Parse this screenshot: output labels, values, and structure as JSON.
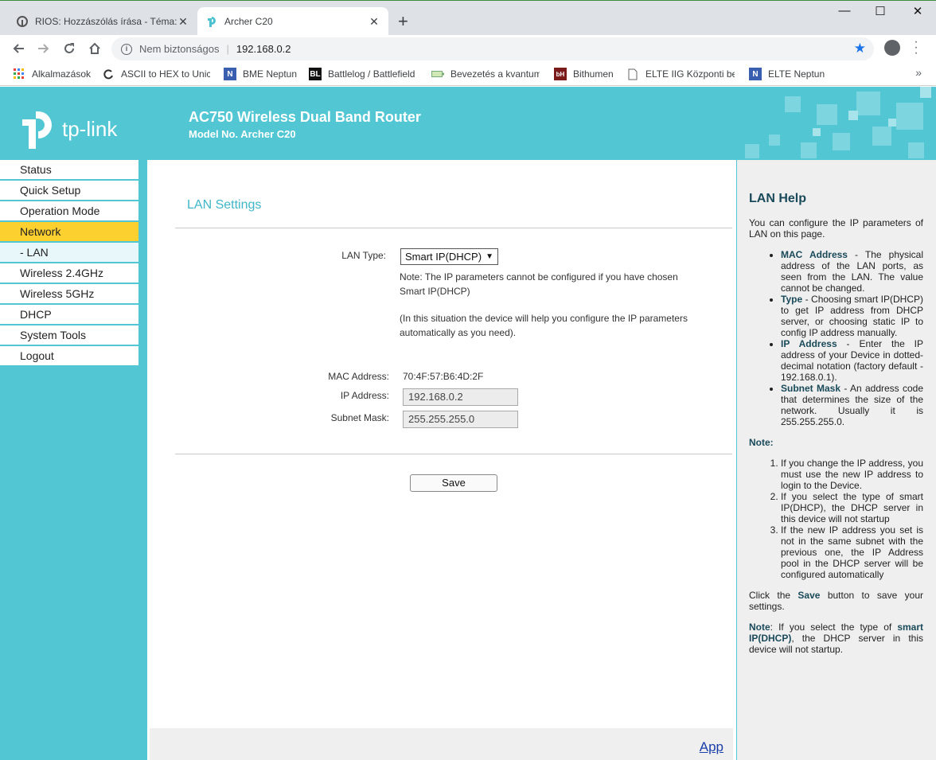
{
  "browser": {
    "tabs": [
      {
        "title": "RIOS: Hozzászólás írása - Téma: M",
        "active": false
      },
      {
        "title": "Archer C20",
        "active": true
      }
    ],
    "new_tab": "+",
    "window": {
      "minimize": "—",
      "maximize": "☐",
      "close": "✕"
    },
    "security_label": "Nem biztonságos",
    "url": "192.168.0.2",
    "bookmarks": [
      {
        "label": "Alkalmazások",
        "icon": "apps-grid-icon"
      },
      {
        "label": "ASCII to HEX to Unico",
        "icon": "rotate-icon"
      },
      {
        "label": "BME Neptun",
        "icon": "neptun-icon"
      },
      {
        "label": "Battlelog / Battlefield",
        "icon": "battlelog-icon"
      },
      {
        "label": "Bevezetés a kvantum",
        "icon": "battery-icon"
      },
      {
        "label": "Bithumen",
        "icon": "bithumen-icon"
      },
      {
        "label": "ELTE IIG Központi bej",
        "icon": "page-icon"
      },
      {
        "label": "ELTE Neptun",
        "icon": "neptun-icon"
      }
    ],
    "bookmarks_more": "»"
  },
  "header": {
    "brand": "tp-link",
    "title": "AC750 Wireless Dual Band Router",
    "model": "Model No. Archer C20"
  },
  "sidebar": {
    "items": [
      {
        "label": "Status",
        "state": "normal"
      },
      {
        "label": "Quick Setup",
        "state": "normal"
      },
      {
        "label": "Operation Mode",
        "state": "normal"
      },
      {
        "label": "Network",
        "state": "active"
      },
      {
        "label": "- LAN",
        "state": "sub"
      },
      {
        "label": "Wireless 2.4GHz",
        "state": "normal"
      },
      {
        "label": "Wireless 5GHz",
        "state": "normal"
      },
      {
        "label": "DHCP",
        "state": "normal"
      },
      {
        "label": "System Tools",
        "state": "normal"
      },
      {
        "label": "Logout",
        "state": "normal"
      }
    ]
  },
  "main": {
    "title": "LAN Settings",
    "lan_type_label": "LAN Type:",
    "lan_type_value": "Smart IP(DHCP)",
    "note1_line1": "Note: The IP parameters cannot be configured if you have chosen",
    "note1_line2": "Smart IP(DHCP)",
    "note2_line1": "(In this situation the device will help you configure the IP parameters",
    "note2_line2": "automatically as you need).",
    "mac_label": "MAC Address:",
    "mac_value": "70:4F:57:B6:4D:2F",
    "ip_label": "IP Address:",
    "ip_value": "192.168.0.2",
    "mask_label": "Subnet Mask:",
    "mask_value": "255.255.255.0",
    "save_label": "Save",
    "footer_link": "App"
  },
  "help": {
    "title": "LAN Help",
    "intro": "You can configure the IP parameters of LAN on this page.",
    "bullets": [
      {
        "term": "MAC Address",
        "text": " - The physical address of the LAN ports, as seen from the LAN. The value cannot be changed."
      },
      {
        "term": "Type",
        "text": " - Choosing smart IP(DHCP) to get IP address from DHCP server, or choosing static IP to config IP address manually."
      },
      {
        "term": "IP Address",
        "text": " - Enter the IP address of your Device in dotted-decimal notation (factory default - 192.168.0.1)."
      },
      {
        "term": "Subnet Mask",
        "text": " - An address code that determines the size of the network. Usually it is 255.255.255.0."
      }
    ],
    "note_title": "Note:",
    "notes": [
      "If you change the IP address, you must use the new IP address to login to the Device.",
      "If you select the type of smart IP(DHCP), the DHCP server in this device will not startup",
      "If the new IP address you set is not in the same subnet with the previous one, the IP Address pool in the DHCP server will be configured automatically"
    ],
    "click_pre": "Click the ",
    "click_term": "Save",
    "click_post": " button to save your settings.",
    "final_note_term": "Note",
    "final_note_pre": ": If you select the type of ",
    "final_note_mid": "smart IP(DHCP)",
    "final_note_post": ", the DHCP server in this device will not startup."
  }
}
